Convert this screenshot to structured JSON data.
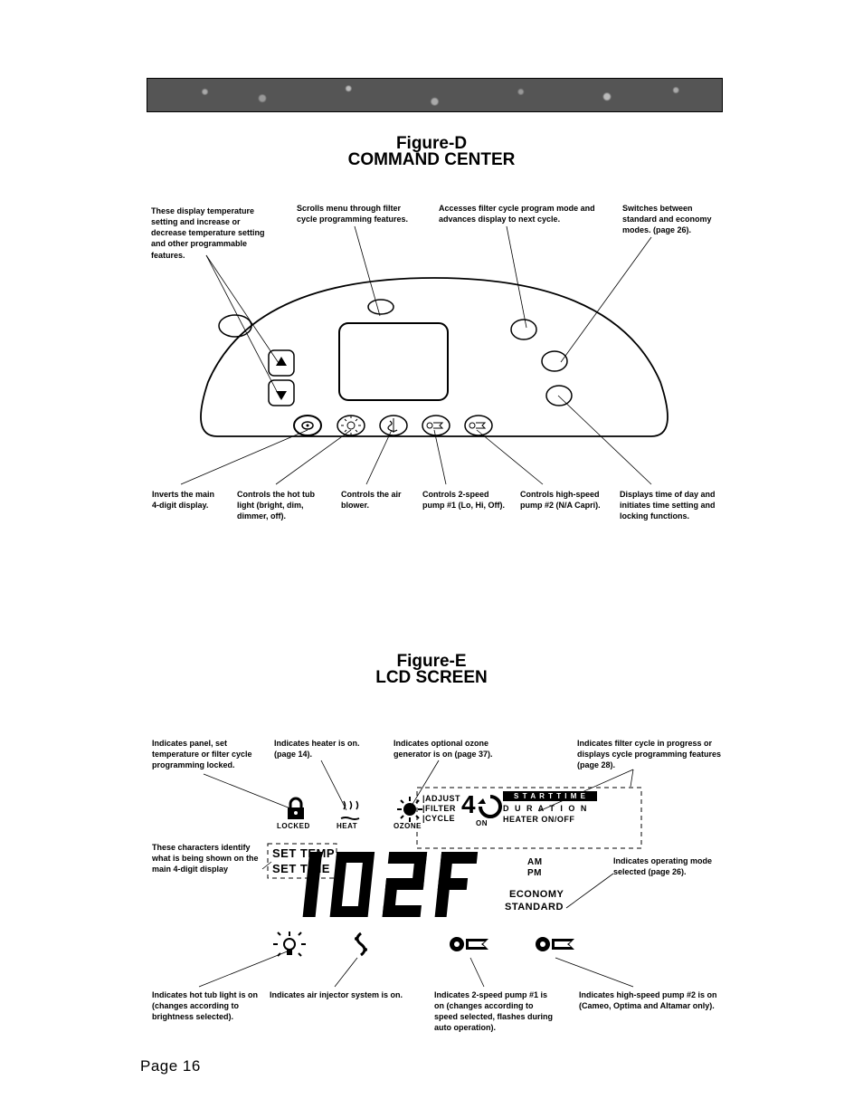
{
  "figureD": {
    "title": "Figure-D",
    "subtitle": "COMMAND CENTER",
    "callouts": {
      "topLeft": "These display temperature setting and increase or decrease temperature setting and other programmable features.",
      "topMid1": "Scrolls menu through filter cycle programming features.",
      "topMid2": "Accesses filter cycle program mode and advances display to next cycle.",
      "topRight": "Switches between standard and economy modes. (page 26).",
      "botInvert": "Inverts the main 4-digit display.",
      "botLight": "Controls the hot tub light (bright, dim, dimmer, off).",
      "botBlower": "Controls the air blower.",
      "botPump1": "Controls 2-speed pump #1 (Lo, Hi, Off).",
      "botPump2": "Controls high-speed pump #2 (N/A Capri).",
      "botTime": "Displays time of day and initiates time setting and locking functions."
    }
  },
  "figureE": {
    "title": "Figure-E",
    "subtitle": "LCD SCREEN",
    "callouts": {
      "locked": "Indicates panel, set temperature or filter cycle programming locked.",
      "heater": "Indicates heater is on. (page 14).",
      "ozone": "Indicates optional ozone generator is on (page 37).",
      "filter": "Indicates filter cycle in progress or displays cycle programming features (page 28).",
      "chars": "These characters identify what is being shown on the main 4-digit display",
      "mode": "Indicates operating mode selected (page 26).",
      "light": "Indicates hot tub light is on (changes according to brightness selected).",
      "air": "Indicates air injector system is on.",
      "p1": "Indicates 2-speed pump #1 is on (changes according to speed selected, flashes during auto operation).",
      "p2": "Indicates high-speed pump #2 is on (Cameo, Optima and Altamar only)."
    },
    "lcd": {
      "locked": "LOCKED",
      "heat": "HEAT",
      "ozone": "OZONE",
      "settemp": "SET TEMP",
      "settime": "SET TIME",
      "adjust": "ADJUST",
      "filter": "FILTER",
      "cycle": "CYCLE",
      "num": "4",
      "on": "ON",
      "starttime": "S T A R T  T I M E",
      "duration": "D U R A T I O N",
      "heateronoff": "HEATER ON/OFF",
      "main": "102F",
      "am": "AM",
      "pm": "PM",
      "economy": "ECONOMY",
      "standard": "STANDARD"
    }
  },
  "pageNumber": "Page 16"
}
